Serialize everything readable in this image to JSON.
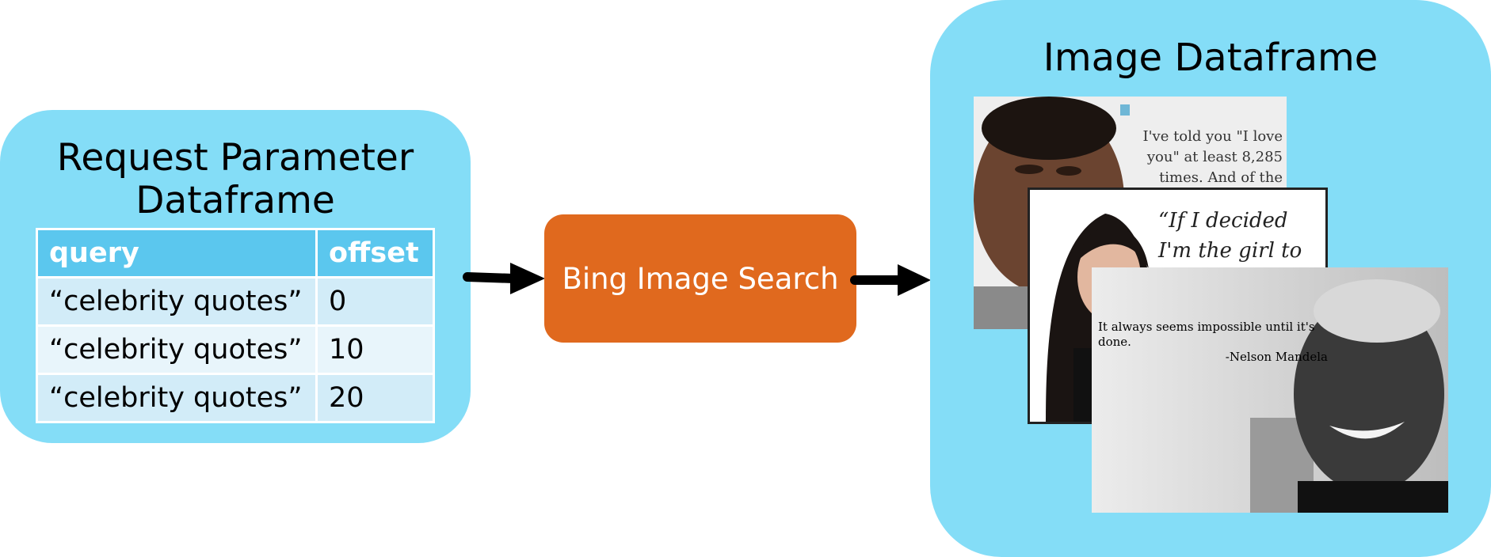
{
  "left_panel": {
    "title_line1": "Request Parameter",
    "title_line2": "Dataframe",
    "table": {
      "headers": [
        "query",
        "offset"
      ],
      "rows": [
        [
          "“celebrity quotes”",
          "0"
        ],
        [
          "“celebrity quotes”",
          "10"
        ],
        [
          "“celebrity quotes”",
          "20"
        ]
      ]
    }
  },
  "process": {
    "label": "Bing Image Search"
  },
  "right_panel": {
    "title": "Image Dataframe",
    "images": [
      {
        "quote": "I've told you \"I love you\" at least 8,285 times. And of the"
      },
      {
        "quote": "“If I decided I'm the girl to change"
      },
      {
        "quote_line1": "It always seems impossible until it's done.",
        "quote_line2": "-Nelson Mandela"
      }
    ]
  },
  "colors": {
    "panel": "#84ddf7",
    "table_header": "#5bc7ee",
    "table_row_odd": "#d2ecf8",
    "table_row_even": "#e8f5fb",
    "process_box": "#e0691e",
    "arrow": "#000000"
  }
}
